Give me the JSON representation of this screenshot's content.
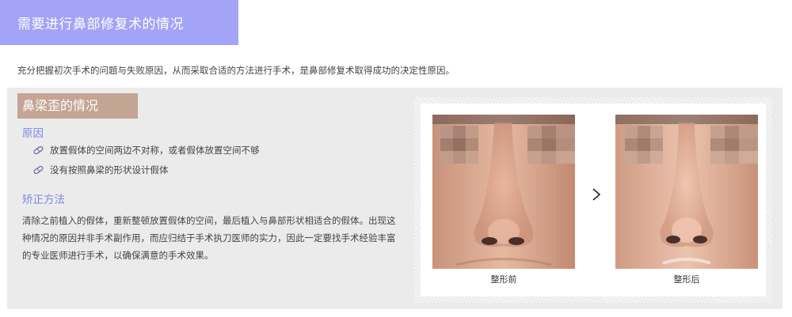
{
  "header": {
    "title": "需要进行鼻部修复术的情况"
  },
  "intro": "充分把握初次手术的问题与失败原因，从而采取合适的方法进行手术，是鼻部修复术取得成功的决定性原因。",
  "section": {
    "title": "鼻梁歪的情况",
    "cause_heading": "原因",
    "causes": [
      "放置假体的空间两边不对称，或者假体放置空间不够",
      "没有按照鼻梁的形状设计假体"
    ],
    "fix_heading": "矫正方法",
    "fix_text": "清除之前植入的假体，重新整顿放置假体的空间，最后植入与鼻部形状相适合的假体。出现这种情况的原因并非手术副作用，而应归结于手术执刀医师的实力，因此一定要找手术经验丰富的专业医师进行手术，以确保满意的手术效果。"
  },
  "photos": {
    "before_caption": "整形前",
    "after_caption": "整形后",
    "arrow_icon": "chevron-right-icon"
  },
  "colors": {
    "header_bg": "#a3a3f7",
    "section_title_bg": "#c4a493",
    "subheading": "#7f86e8",
    "panel_bg": "#ebebeb"
  }
}
